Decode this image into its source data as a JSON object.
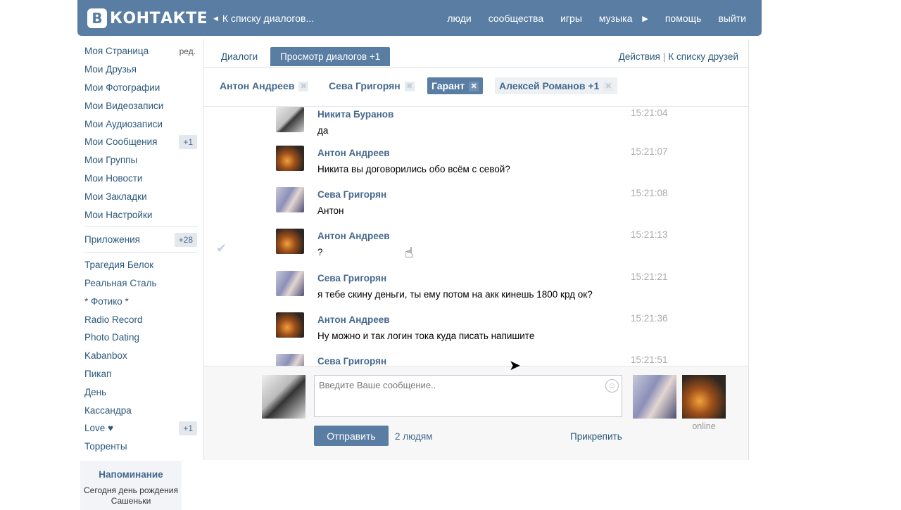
{
  "header": {
    "logo_badge": "В",
    "logo_text": "КОНТАКТЕ",
    "back_link": "К списку диалогов...",
    "nav": [
      "люди",
      "сообщества",
      "игры",
      "музыка",
      "помощь",
      "выйти"
    ]
  },
  "leftmenu": {
    "main": [
      {
        "label": "Моя Страница",
        "extra": "ред."
      },
      {
        "label": "Мои Друзья"
      },
      {
        "label": "Мои Фотографии"
      },
      {
        "label": "Мои Видеозаписи"
      },
      {
        "label": "Мои Аудиозаписи"
      },
      {
        "label": "Мои Сообщения",
        "count": "+1"
      },
      {
        "label": "Мои Группы"
      },
      {
        "label": "Мои Новости"
      },
      {
        "label": "Мои Закладки"
      },
      {
        "label": "Мои Настройки"
      }
    ],
    "apps": {
      "label": "Приложения",
      "count": "+28"
    },
    "app_items": [
      {
        "label": "Трагедия Белок"
      },
      {
        "label": "Реальная Сталь"
      },
      {
        "label": "* Фотико *"
      },
      {
        "label": "Radio Record"
      },
      {
        "label": "Photo Dating"
      },
      {
        "label": "Kabanbox"
      },
      {
        "label": "Пикап"
      },
      {
        "label": "День"
      },
      {
        "label": "Кассандра"
      },
      {
        "label": "Love ♥",
        "count": "+1"
      },
      {
        "label": "Торренты"
      }
    ],
    "reminder": {
      "title": "Напоминание",
      "text": "Сегодня день рождения Сашеньки"
    }
  },
  "tabs": {
    "dialogs": "Диалоги",
    "view": "Просмотр диалогов +1",
    "actions": "Действия",
    "separator": "|",
    "friends": "К списку друзей"
  },
  "participants": [
    {
      "name": "Антон Андреев",
      "x": "✖"
    },
    {
      "name": "Сева Григорян",
      "x": "✖"
    },
    {
      "name": "Гарант",
      "x": "✖"
    },
    {
      "name": "Алексей Романов +1",
      "x": "✖"
    }
  ],
  "messages": [
    {
      "author": "Никита Буранов",
      "time": "15:21:04",
      "text": "да",
      "avatar": "nikita"
    },
    {
      "author": "Антон Андреев",
      "time": "15:21:07",
      "text": "Никита вы договорились обо всём с севой?",
      "avatar": "anton"
    },
    {
      "author": "Сева Григорян",
      "time": "15:21:08",
      "text": "Антон",
      "avatar": "seva"
    },
    {
      "author": "Антон Андреев",
      "time": "15:21:13",
      "text": "?",
      "avatar": "anton",
      "check": "✔"
    },
    {
      "author": "Сева Григорян",
      "time": "15:21:21",
      "text": "я тебе скину деньги, ты ему потом на акк кинешь 1800 крд ок?",
      "avatar": "seva"
    },
    {
      "author": "Антон Андреев",
      "time": "15:21:36",
      "text": "Ну можно и так логин тока куда писать напишите",
      "avatar": "anton"
    },
    {
      "author": "Сева Григорян",
      "time": "15:21:51",
      "text": "",
      "avatar": "seva"
    }
  ],
  "composer": {
    "placeholder": "Введите Ваше сообщение..",
    "send_label": "Отправить",
    "recipients": "2 людям",
    "attach": "Прикрепить",
    "online": "online",
    "smile": "☺"
  },
  "colors": {
    "brand": "#597da3",
    "link": "#2b587a",
    "name": "#45688e"
  }
}
